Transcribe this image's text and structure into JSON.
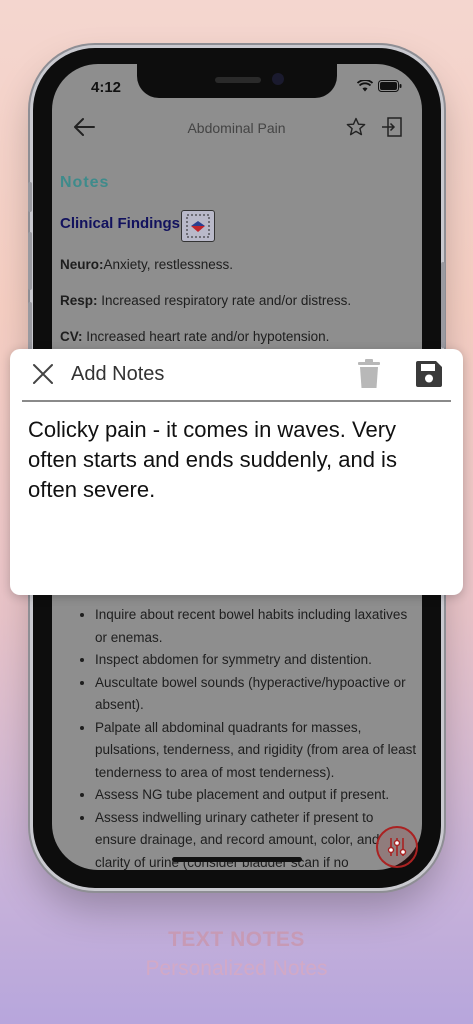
{
  "status_bar": {
    "time": "4:12"
  },
  "nav": {
    "title": "Abdominal Pain",
    "back_icon": "back-arrow-icon",
    "star_icon": "star-icon",
    "exit_icon": "exit-icon"
  },
  "content": {
    "section_title": "Notes",
    "clinical_findings_title": "Clinical Findings",
    "findings": [
      {
        "label": "Neuro:",
        "text": "Anxiety, restlessness."
      },
      {
        "label": "Resp:",
        "text": " Increased respiratory rate and/or distress."
      },
      {
        "label": "CV:",
        "text": " Increased heart rate and/or hypotension."
      }
    ],
    "bullets": [
      "Inquire about recent bowel habits including laxatives or enemas.",
      "Inspect abdomen for symmetry and distention.",
      "Auscultate bowel sounds (hyperactive/hypoactive or absent).",
      "Palpate all abdominal quadrants for masses, pulsations, tenderness, and rigidity (from area of least tenderness to area of most tenderness).",
      "Assess NG tube placement and output if present.",
      "Assess indwelling urinary catheter if present to ensure drainage, and record amount, color, and clarity of urine (consider bladder scan if no"
    ]
  },
  "modal": {
    "title": "Add Notes",
    "note_text": "Colicky pain -  it comes in waves. Very often starts and ends suddenly, and is often severe."
  },
  "promo": {
    "title": "TEXT NOTES",
    "subtitle": "Personalized Notes"
  },
  "colors": {
    "accent_teal": "#3e8b8b",
    "navy": "#12125e",
    "promo": "#c79ab5"
  }
}
